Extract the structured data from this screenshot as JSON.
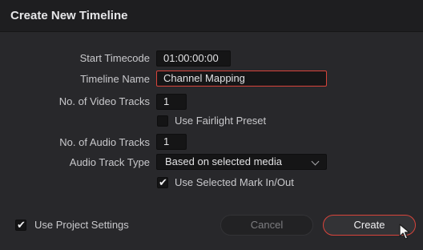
{
  "dialog": {
    "title": "Create New Timeline"
  },
  "fields": {
    "start_timecode": {
      "label": "Start Timecode",
      "value": "01:00:00:00"
    },
    "timeline_name": {
      "label": "Timeline Name",
      "value": "Channel Mapping"
    },
    "video_tracks": {
      "label": "No. of Video Tracks",
      "value": "1"
    },
    "fairlight_preset": {
      "label": "Use Fairlight Preset",
      "checked": false
    },
    "audio_tracks": {
      "label": "No. of Audio Tracks",
      "value": "1"
    },
    "audio_track_type": {
      "label": "Audio Track Type",
      "value": "Based on selected media"
    },
    "mark_in_out": {
      "label": "Use Selected Mark In/Out",
      "checked": true
    }
  },
  "footer": {
    "project_settings": {
      "label": "Use Project Settings",
      "checked": true
    },
    "cancel_label": "Cancel",
    "create_label": "Create"
  },
  "colors": {
    "accent": "#d8443b",
    "background": "#28282b",
    "titlebar": "#1e1e20",
    "field": "#151516"
  },
  "icons": {
    "checkmark": "checkmark-icon",
    "dropdown": "chevron-down-icon",
    "cursor": "mouse-pointer-icon"
  }
}
